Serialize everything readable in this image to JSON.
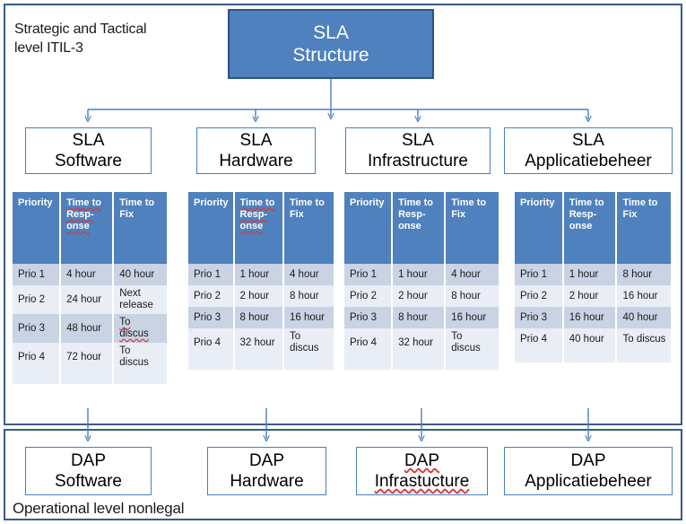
{
  "panels": {
    "top_label": "Strategic and Tactical\nlevel ITIL-3",
    "bottom_label": "Operational level nonlegal"
  },
  "root": {
    "label": "SLA\nStructure",
    "fill": "#4e81bd",
    "border": "#2d5383",
    "text_color": "#ffffff"
  },
  "colors": {
    "panel_border": "#3a5b87",
    "connector": "#4a7ebb",
    "node_border": "#4a7ebb",
    "table_header_bg": "#4e81bd",
    "table_row_odd": "#c9d3e4",
    "table_row_even": "#e9edf5",
    "spell_error": "#e03131"
  },
  "sla_nodes": [
    {
      "label": "SLA\nSoftware"
    },
    {
      "label": "SLA\nHardware"
    },
    {
      "label": "SLA\nInfrastructure"
    },
    {
      "label": "SLA\nApplicatiebeheer"
    }
  ],
  "dap_nodes": [
    {
      "label": "DAP\nSoftware",
      "misspelled": false
    },
    {
      "label": "DAP\nHardware",
      "misspelled": false
    },
    {
      "label": "DAP\nInfrastucture",
      "misspelled": true
    },
    {
      "label": "DAP\nApplicatiebeheer",
      "misspelled": false
    }
  ],
  "tables": [
    {
      "name": "SLA Software",
      "headers": [
        "Priority",
        "Time to\nResp-\nonse",
        "Time to\nFix"
      ],
      "rows": [
        [
          "Prio 1",
          "4 hour",
          "40 hour"
        ],
        [
          "Prio 2",
          "24 hour",
          "Next\nrelease"
        ],
        [
          "Prio 3",
          "48 hour",
          "To discus"
        ],
        [
          "Prio 4",
          "72 hour",
          "To discus"
        ]
      ]
    },
    {
      "name": "SLA Hardware",
      "headers": [
        "Priority",
        "Time to\nResp-\nonse",
        "Time to\nFix"
      ],
      "rows": [
        [
          "Prio 1",
          "1 hour",
          "4 hour"
        ],
        [
          "Prio 2",
          "2 hour",
          "8 hour"
        ],
        [
          "Prio 3",
          "8 hour",
          "16 hour"
        ],
        [
          "Prio 4",
          "32 hour",
          "To discus"
        ]
      ]
    },
    {
      "name": "SLA Infrastructure",
      "headers": [
        "Priority",
        "Time to\nResp-\nonse",
        "Time to\nFix"
      ],
      "rows": [
        [
          "Prio 1",
          "1 hour",
          "4 hour"
        ],
        [
          "Prio 2",
          "2 hour",
          "8 hour"
        ],
        [
          "Prio 3",
          "8 hour",
          "16 hour"
        ],
        [
          "Prio 4",
          "32 hour",
          "To discus"
        ]
      ]
    },
    {
      "name": "SLA Applicatiebeheer",
      "headers": [
        "Priority",
        "Time to\nResp-\nonse",
        "Time to\nFix"
      ],
      "rows": [
        [
          "Prio 1",
          "1 hour",
          "8 hour"
        ],
        [
          "Prio 2",
          "2 hour",
          "16 hour"
        ],
        [
          "Prio 3",
          "16 hour",
          "40 hour"
        ],
        [
          "Prio 4",
          "40 hour",
          "To discus"
        ]
      ]
    }
  ]
}
